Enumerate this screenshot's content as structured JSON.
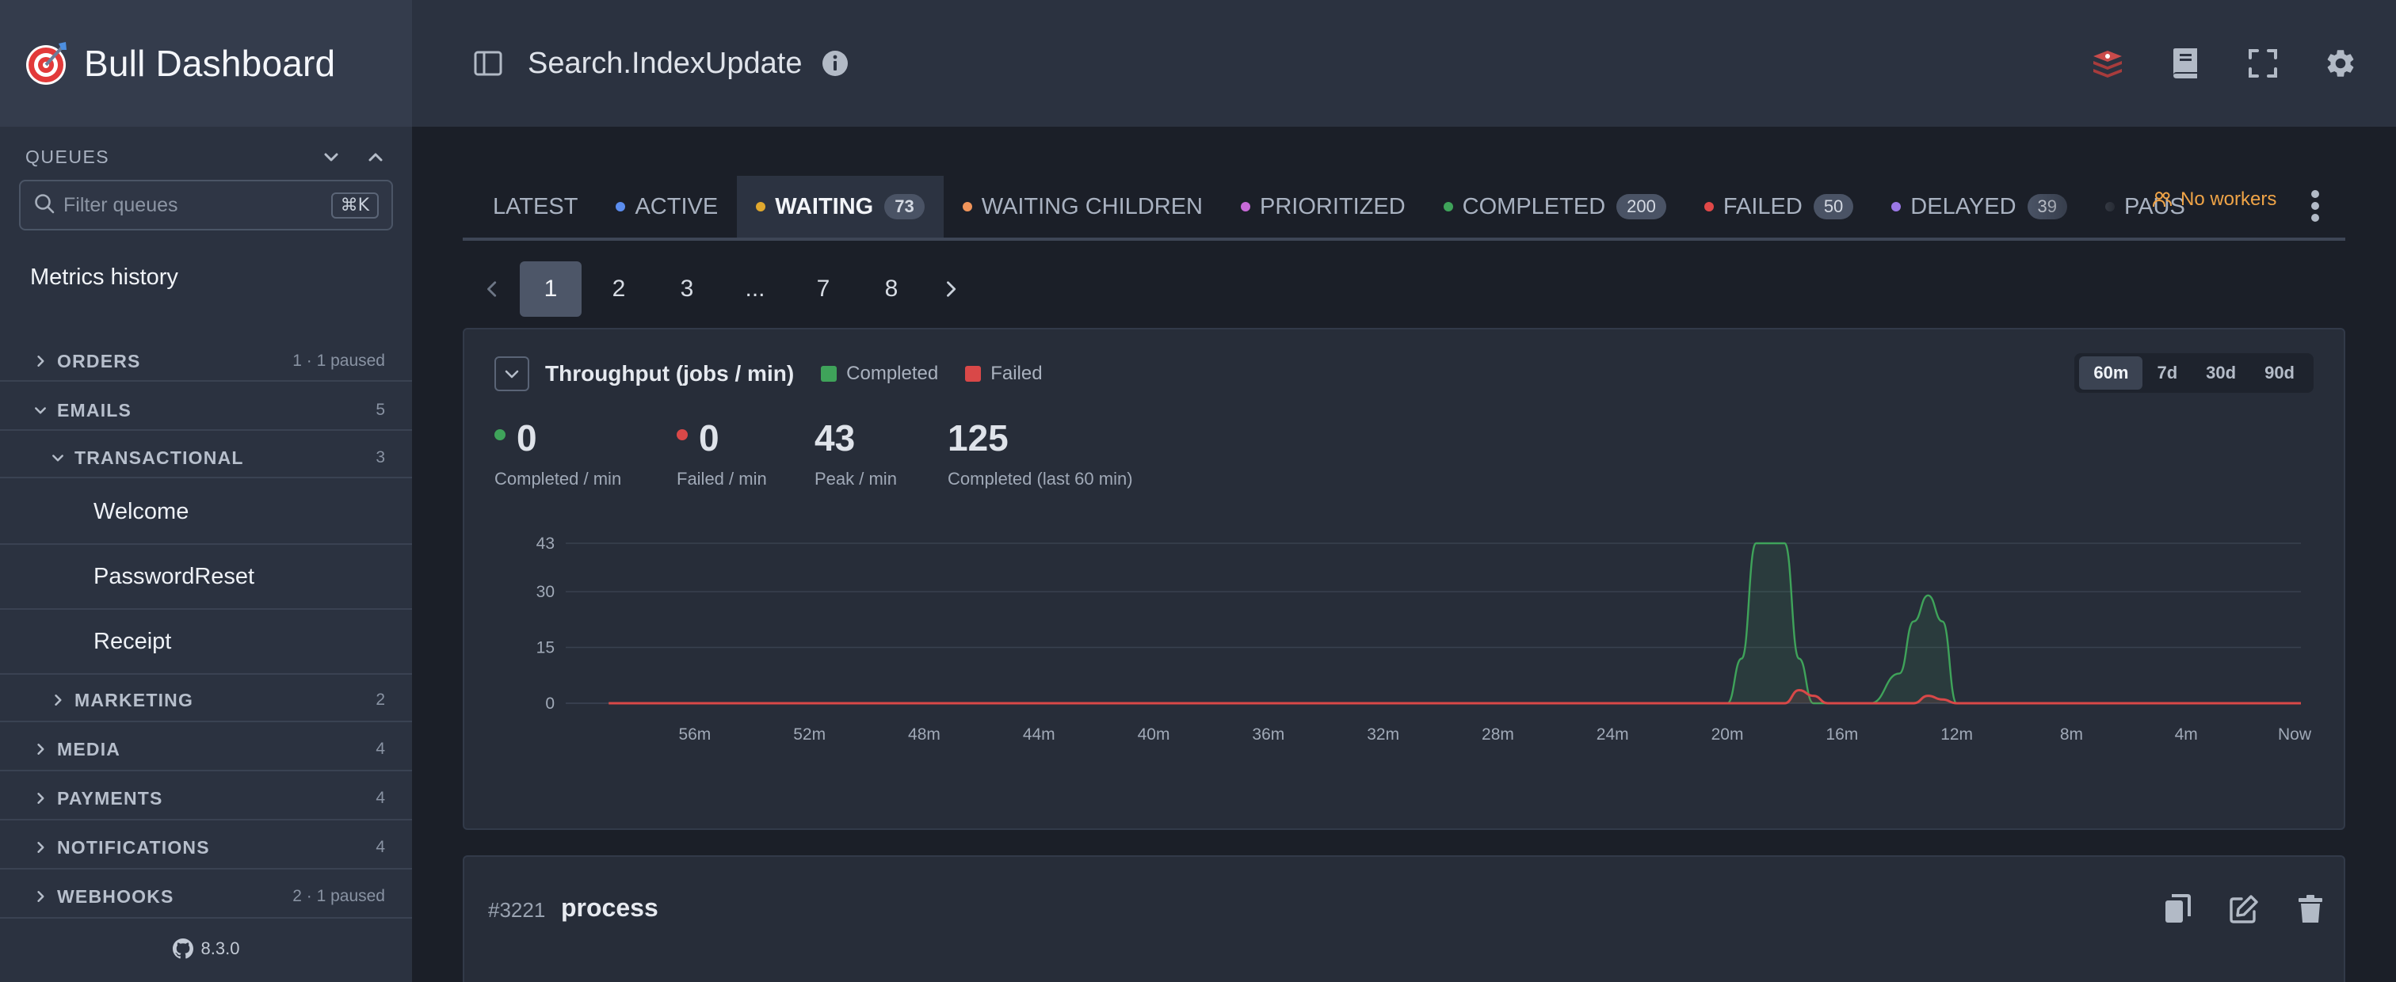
{
  "app": {
    "title": "Bull Dashboard",
    "version": "8.3.0"
  },
  "sidebar": {
    "queues_label": "QUEUES",
    "filter_placeholder": "Filter queues",
    "filter_shortcut": "⌘K",
    "metrics_link": "Metrics history",
    "groups": [
      {
        "name": "ORDERS",
        "meta": "1 · 1 paused",
        "expanded": false
      },
      {
        "name": "EMAILS",
        "meta": "5",
        "expanded": true
      },
      {
        "name": "TRANSACTIONAL",
        "meta": "3",
        "expanded": true
      },
      {
        "name": "MARKETING",
        "meta": "2",
        "expanded": false
      },
      {
        "name": "MEDIA",
        "meta": "4",
        "expanded": false
      },
      {
        "name": "PAYMENTS",
        "meta": "4",
        "expanded": false
      },
      {
        "name": "NOTIFICATIONS",
        "meta": "4",
        "expanded": false
      },
      {
        "name": "WEBHOOKS",
        "meta": "2 · 1 paused",
        "expanded": false
      }
    ],
    "leaves": [
      "Welcome",
      "PasswordReset",
      "Receipt"
    ]
  },
  "header": {
    "queue_name": "Search.IndexUpdate"
  },
  "tabs": [
    {
      "label": "LATEST",
      "color": "",
      "count": ""
    },
    {
      "label": "ACTIVE",
      "color": "#5b8def",
      "count": ""
    },
    {
      "label": "WAITING",
      "color": "#e0a82e",
      "count": "73",
      "active": true
    },
    {
      "label": "WAITING CHILDREN",
      "color": "#f0945a",
      "count": ""
    },
    {
      "label": "PRIORITIZED",
      "color": "#c86ad8",
      "count": ""
    },
    {
      "label": "COMPLETED",
      "color": "#3fa35a",
      "count": "200"
    },
    {
      "label": "FAILED",
      "color": "#e04848",
      "count": "50"
    },
    {
      "label": "DELAYED",
      "color": "#9b78e6",
      "count": "39"
    },
    {
      "label": "PAUS",
      "color": "#a0a8b4",
      "count": ""
    }
  ],
  "no_workers": "No workers",
  "pagination": {
    "pages": [
      "1",
      "2",
      "3",
      "...",
      "7",
      "8"
    ],
    "current": "1"
  },
  "throughput": {
    "title": "Throughput (jobs / min)",
    "legend": [
      {
        "label": "Completed",
        "color": "#3fa35a"
      },
      {
        "label": "Failed",
        "color": "#d94848"
      }
    ],
    "ranges": [
      "60m",
      "7d",
      "30d",
      "90d"
    ],
    "active_range": "60m",
    "stats": [
      {
        "value": "0",
        "label": "Completed / min",
        "dot": "#3fa35a"
      },
      {
        "value": "0",
        "label": "Failed / min",
        "dot": "#d94848"
      },
      {
        "value": "43",
        "label": "Peak / min",
        "dot": ""
      },
      {
        "value": "125",
        "label": "Completed (last 60 min)",
        "dot": ""
      }
    ]
  },
  "chart_data": {
    "type": "area",
    "x_labels": [
      "56m",
      "52m",
      "48m",
      "44m",
      "40m",
      "36m",
      "32m",
      "28m",
      "24m",
      "20m",
      "16m",
      "12m",
      "8m",
      "4m",
      "Now"
    ],
    "y_ticks": [
      0,
      15,
      30,
      43
    ],
    "ylim": [
      0,
      43
    ],
    "x_minutes_ago": [
      59,
      20,
      19.5,
      19,
      18.5,
      18,
      17.5,
      17,
      16.5,
      16,
      15,
      14,
      13.5,
      13,
      12.5,
      12,
      11.5,
      0
    ],
    "series": [
      {
        "name": "Completed",
        "color": "#3fa35a",
        "values": [
          0,
          0,
          12,
          43,
          43,
          43,
          12,
          0,
          0,
          0,
          0,
          8,
          22,
          29,
          22,
          0,
          0,
          0
        ]
      },
      {
        "name": "Failed",
        "color": "#d94848",
        "values": [
          0,
          0,
          0,
          0,
          0,
          0,
          3.5,
          2,
          0,
          0,
          0,
          0,
          0,
          2,
          1,
          0,
          0,
          0
        ]
      }
    ],
    "grid": true,
    "legend_position": "top-left"
  },
  "job": {
    "id": "#3221",
    "name": "process"
  }
}
